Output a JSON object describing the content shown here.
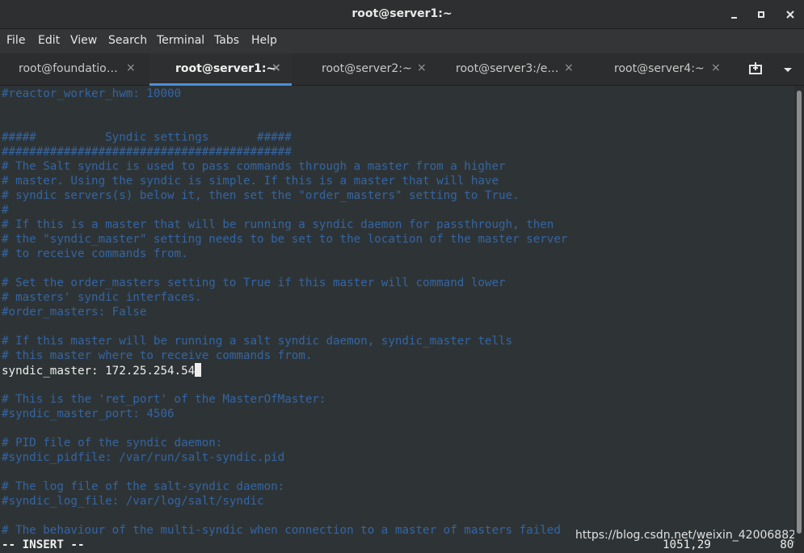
{
  "window": {
    "title": "root@server1:~",
    "minimize_icon": "minimize-icon",
    "maximize_icon": "maximize-icon",
    "close_icon": "close-icon"
  },
  "menu": {
    "items": [
      "File",
      "Edit",
      "View",
      "Search",
      "Terminal",
      "Tabs",
      "Help"
    ]
  },
  "tabs": [
    {
      "label": "root@foundatio…",
      "active": false
    },
    {
      "label": "root@server1:~",
      "active": true
    },
    {
      "label": "root@server2:~",
      "active": false
    },
    {
      "label": "root@server3:/e…",
      "active": false
    },
    {
      "label": "root@server4:~",
      "active": false
    }
  ],
  "tab_close_glyph": "×",
  "tab_actions": {
    "new_tab_icon": "new-tab-icon",
    "tab_menu_icon": "chevron-down-icon"
  },
  "colors": {
    "terminal_bg": "#2e3436",
    "comment": "#3465a4",
    "text": "#eeeeec",
    "active_tab_accent": "#4a90d9"
  },
  "editor": {
    "lines": [
      {
        "text": "#reactor_worker_hwm: 10000",
        "kind": "comment"
      },
      {
        "text": "",
        "kind": "comment"
      },
      {
        "text": "",
        "kind": "comment"
      },
      {
        "text": "#####          Syndic settings       #####",
        "kind": "comment"
      },
      {
        "text": "##########################################",
        "kind": "comment"
      },
      {
        "text": "# The Salt syndic is used to pass commands through a master from a higher",
        "kind": "comment"
      },
      {
        "text": "# master. Using the syndic is simple. If this is a master that will have",
        "kind": "comment"
      },
      {
        "text": "# syndic servers(s) below it, then set the \"order_masters\" setting to True.",
        "kind": "comment"
      },
      {
        "text": "#",
        "kind": "comment"
      },
      {
        "text": "# If this is a master that will be running a syndic daemon for passthrough, then",
        "kind": "comment"
      },
      {
        "text": "# the \"syndic_master\" setting needs to be set to the location of the master server",
        "kind": "comment"
      },
      {
        "text": "# to receive commands from.",
        "kind": "comment"
      },
      {
        "text": "",
        "kind": "comment"
      },
      {
        "text": "# Set the order_masters setting to True if this master will command lower",
        "kind": "comment"
      },
      {
        "text": "# masters' syndic interfaces.",
        "kind": "comment"
      },
      {
        "text": "#order_masters: False",
        "kind": "comment"
      },
      {
        "text": "",
        "kind": "comment"
      },
      {
        "text": "# If this master will be running a salt syndic daemon, syndic_master tells",
        "kind": "comment"
      },
      {
        "text": "# this master where to receive commands from.",
        "kind": "comment"
      },
      {
        "text": "syndic_master: 172.25.254.54",
        "kind": "text",
        "cursor": true
      },
      {
        "text": "",
        "kind": "comment"
      },
      {
        "text": "# This is the 'ret_port' of the MasterOfMaster:",
        "kind": "comment"
      },
      {
        "text": "#syndic_master_port: 4506",
        "kind": "comment"
      },
      {
        "text": "",
        "kind": "comment"
      },
      {
        "text": "# PID file of the syndic daemon:",
        "kind": "comment"
      },
      {
        "text": "#syndic_pidfile: /var/run/salt-syndic.pid",
        "kind": "comment"
      },
      {
        "text": "",
        "kind": "comment"
      },
      {
        "text": "# The log file of the salt-syndic daemon:",
        "kind": "comment"
      },
      {
        "text": "#syndic_log_file: /var/log/salt/syndic",
        "kind": "comment"
      },
      {
        "text": "",
        "kind": "comment"
      },
      {
        "text": "# The behaviour of the multi-syndic when connection to a master of masters failed",
        "kind": "comment"
      }
    ],
    "mode": "-- INSERT --",
    "position": "1051,29",
    "scroll_percent": "80%"
  },
  "watermark": "https://blog.csdn.net/weixin_42006882"
}
